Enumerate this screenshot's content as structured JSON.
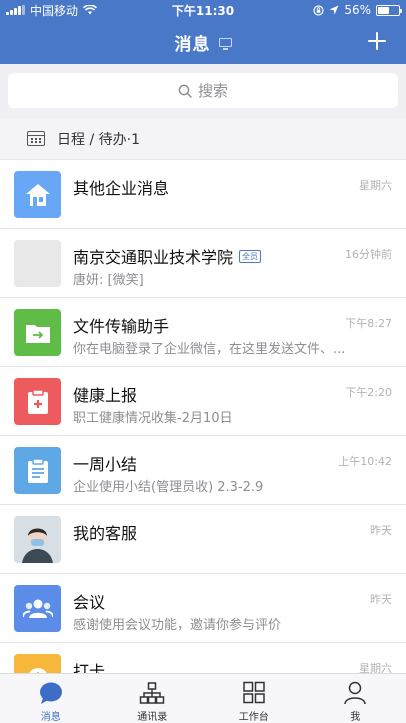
{
  "status_bar": {
    "carrier": "中国移动",
    "time": "下午11:30",
    "battery": "56%",
    "battery_level": 0.56
  },
  "nav": {
    "title": "消息"
  },
  "search": {
    "placeholder": "搜索"
  },
  "schedule": {
    "label": "日程 / 待办·1"
  },
  "messages": [
    {
      "title": "其他企业消息",
      "subtitle": "",
      "time": "星期六",
      "icon": "house-icon",
      "color": "#67a7f5"
    },
    {
      "title": "南京交通职业技术学院",
      "badge": "全员",
      "subtitle": "唐妍: [微笑]",
      "time": "16分钟前",
      "icon": "group-avatar",
      "color": "#dcdcdc"
    },
    {
      "title": "文件传输助手",
      "subtitle": "你在电脑登录了企业微信，在这里发送文件、...",
      "time": "下午8:27",
      "icon": "folder-transfer-icon",
      "color": "#5fbc46"
    },
    {
      "title": "健康上报",
      "subtitle": "职工健康情况收集-2月10日",
      "time": "下午2:20",
      "icon": "medical-clipboard-icon",
      "color": "#ee5b5f"
    },
    {
      "title": "一周小结",
      "subtitle": "企业使用小结(管理员收) 2.3-2.9",
      "time": "上午10:42",
      "icon": "clipboard-icon",
      "color": "#5ea8e5"
    },
    {
      "title": "我的客服",
      "subtitle": "",
      "time": "昨天",
      "icon": "service-avatar",
      "color": "#cfd8df"
    },
    {
      "title": "会议",
      "subtitle": "感谢使用会议功能，邀请你参与评价",
      "time": "昨天",
      "icon": "people-icon",
      "color": "#5b8de8"
    },
    {
      "title": "打卡",
      "subtitle": "",
      "time": "星期六",
      "icon": "clock-icon",
      "color": "#f6b73c"
    }
  ],
  "tabs": [
    {
      "label": "消息",
      "icon": "chat-bubble-icon",
      "active": true
    },
    {
      "label": "通讯录",
      "icon": "org-chart-icon",
      "active": false
    },
    {
      "label": "工作台",
      "icon": "grid-icon",
      "active": false
    },
    {
      "label": "我",
      "icon": "person-icon",
      "active": false
    }
  ],
  "colors": {
    "brand": "#4a78c8",
    "tab_active": "#3c6ec8"
  }
}
